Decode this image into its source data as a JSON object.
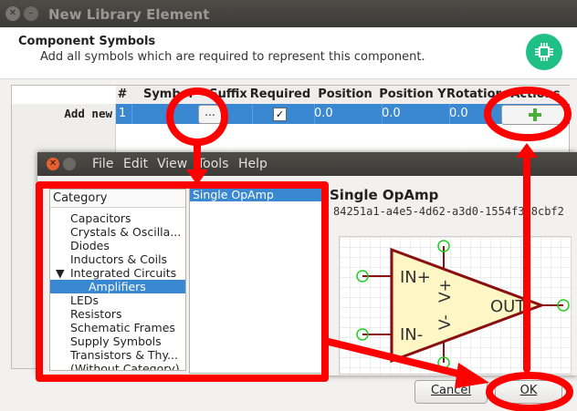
{
  "window": {
    "title": "New Library Element"
  },
  "header": {
    "title": "Component Symbols",
    "subtitle": "Add all symbols which are required to represent this component."
  },
  "table": {
    "columns": [
      "#",
      "Symbol",
      "Suffix",
      "Required",
      "Position X",
      "Position Y",
      "Rotation",
      "Actions"
    ],
    "row_label": "Add new symbol:",
    "row": {
      "number": "1",
      "browse_label": "...",
      "required_check": "✓",
      "pos_x": "0.0",
      "pos_y": "0.0",
      "rotation": "0.0"
    }
  },
  "buttons": {
    "cancel": "Cancel",
    "ok": "OK"
  },
  "dialog": {
    "menu": [
      "File",
      "Edit",
      "View",
      "Tools",
      "Help"
    ],
    "category_header": "Category",
    "categories": [
      "Capacitors",
      "Crystals & Oscilla...",
      "Diodes",
      "Inductors & Coils",
      "Integrated Circuits",
      "Amplifiers",
      "LEDs",
      "Resistors",
      "Schematic Frames",
      "Supply Symbols",
      "Transistors & Thy...",
      "(Without Category)"
    ],
    "symbols": [
      "Single OpAmp"
    ],
    "selected_symbol": "Single OpAmp",
    "selected_uuid": "84251a1-a4e5-4d62-a3d0-1554f3f8cbf2",
    "pins": {
      "in_plus": "IN+",
      "in_minus": "IN-",
      "out": "OUT",
      "v_plus": "V+",
      "v_minus": "V-"
    }
  },
  "colors": {
    "selection": "#3a87d2",
    "annotation": "#ff0000",
    "symbol_outline": "#8b0f0f",
    "symbol_fill": "#fff6c6",
    "pin_marker": "#22cc22",
    "badge": "#1fbf86"
  }
}
